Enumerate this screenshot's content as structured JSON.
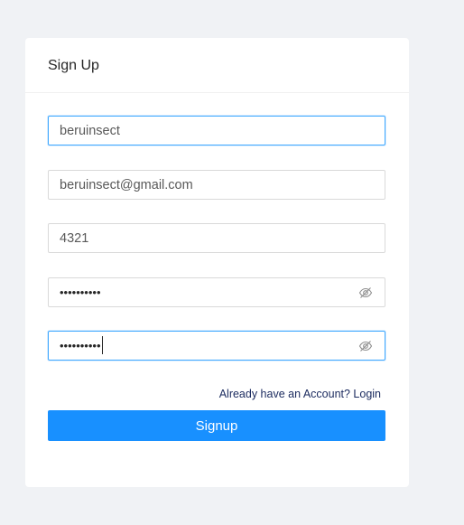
{
  "card": {
    "title": "Sign Up"
  },
  "form": {
    "username": {
      "value": "beruinsect"
    },
    "email": {
      "value": "beruinsect@gmail.com"
    },
    "phone": {
      "value": "4321"
    },
    "password": {
      "value": "••••••••••",
      "icon": "eye-invisible-icon"
    },
    "confirm_password": {
      "value": "••••••••••",
      "icon": "eye-invisible-icon"
    }
  },
  "login_link": "Already have an Account? Login",
  "signup_button": "Signup",
  "colors": {
    "background": "#f0f2f5",
    "card": "#ffffff",
    "primary": "#1890ff",
    "focus_border": "#40a9ff",
    "link": "#1a2a5e"
  }
}
